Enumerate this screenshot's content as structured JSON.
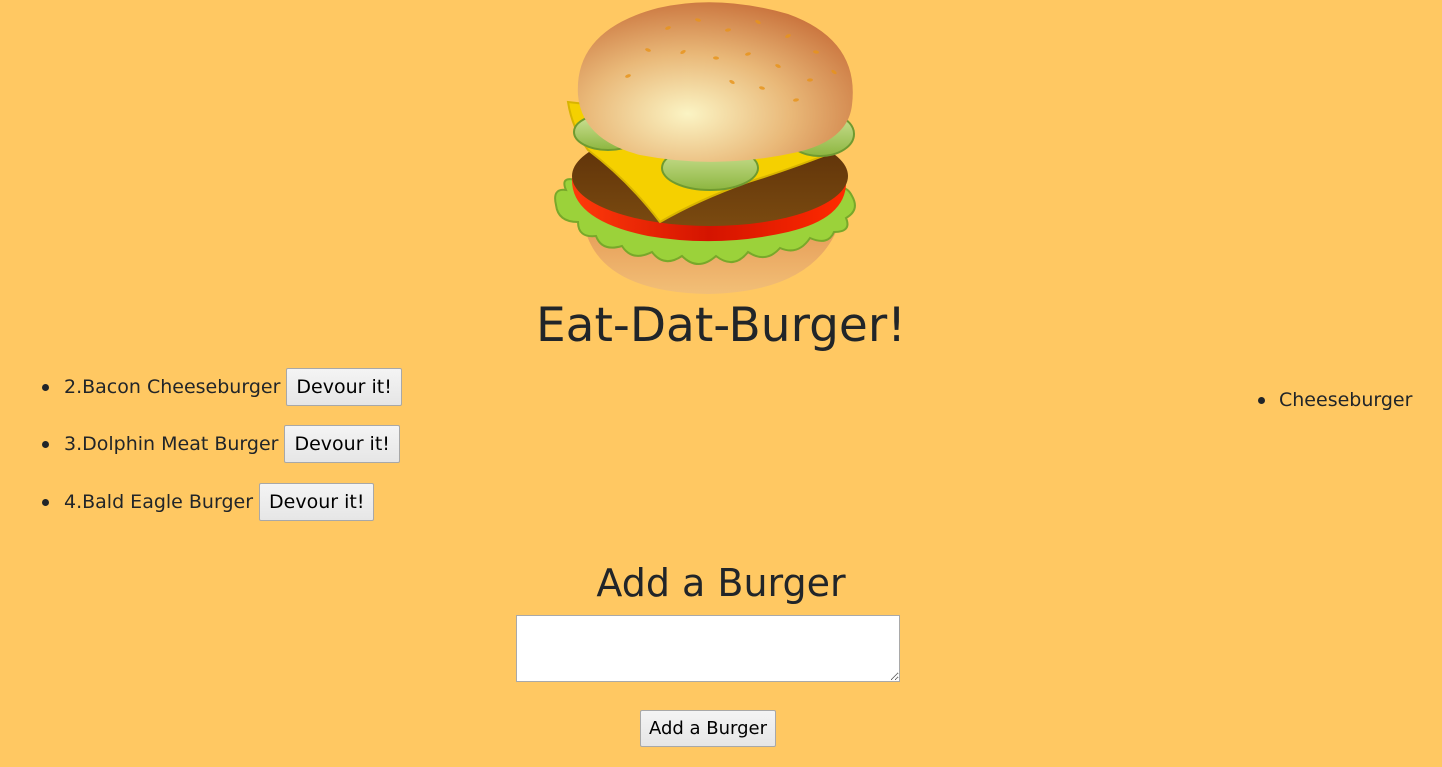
{
  "page": {
    "title": "Eat-Dat-Burger!",
    "logo_icon": "hamburger-icon"
  },
  "burgers": [
    {
      "label": "2.Bacon Cheeseburger",
      "button": "Devour it!"
    },
    {
      "label": "3.Dolphin Meat Burger",
      "button": "Devour it!"
    },
    {
      "label": "4.Bald Eagle Burger",
      "button": "Devour it!"
    }
  ],
  "devoured": [
    {
      "label": "Cheeseburger"
    }
  ],
  "add_form": {
    "title": "Add a Burger",
    "input_value": "",
    "button_label": "Add a Burger"
  },
  "colors": {
    "background": "#ffc862",
    "text": "#212529"
  }
}
